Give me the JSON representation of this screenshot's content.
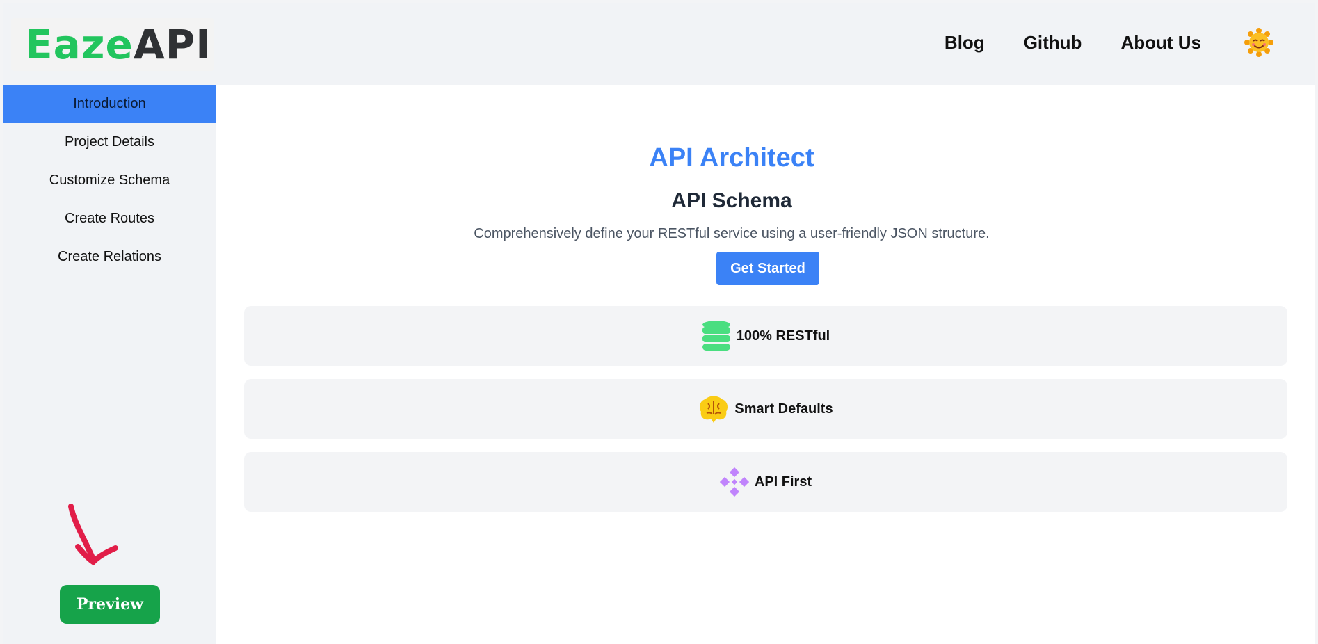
{
  "header": {
    "logo_part1": "Eaze",
    "logo_part2": "API",
    "nav": [
      "Blog",
      "Github",
      "About Us"
    ],
    "avatar_icon": "smiling-sun-icon"
  },
  "sidebar": {
    "items": [
      {
        "label": "Introduction",
        "active": true
      },
      {
        "label": "Project Details",
        "active": false
      },
      {
        "label": "Customize Schema",
        "active": false
      },
      {
        "label": "Create Routes",
        "active": false
      },
      {
        "label": "Create Relations",
        "active": false
      }
    ],
    "preview_label": "Preview"
  },
  "main": {
    "title": "API Architect",
    "subtitle": "API Schema",
    "description": "Comprehensively define your RESTful service using a user-friendly JSON structure.",
    "cta_label": "Get Started",
    "features": [
      {
        "label": "100% RESTful",
        "icon": "database-icon"
      },
      {
        "label": "Smart Defaults",
        "icon": "brain-icon"
      },
      {
        "label": "API First",
        "icon": "diamond-grid-icon"
      }
    ]
  },
  "colors": {
    "accent": "#3b82f6",
    "brand_green": "#22c55e",
    "preview_green": "#16a34a",
    "annotation_red": "#e11d48"
  }
}
